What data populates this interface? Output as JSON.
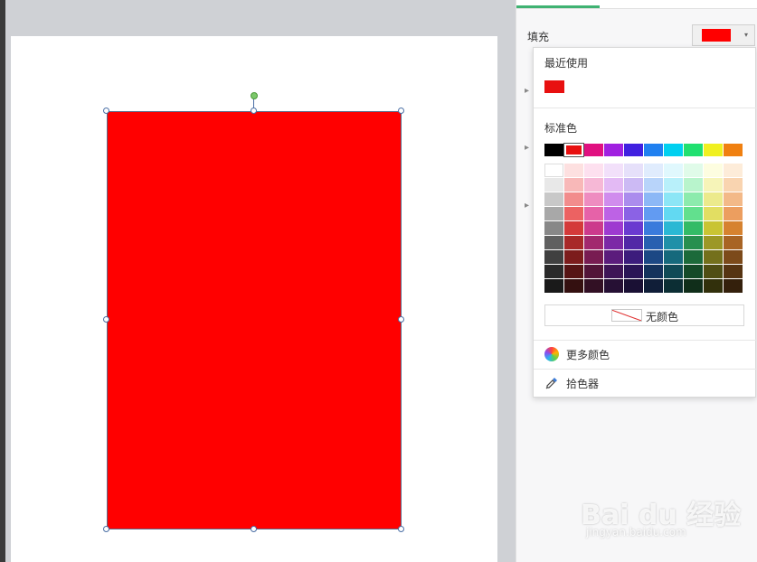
{
  "panel": {
    "fill_label": "填充",
    "fill_color": "#ff0000",
    "dropdown_arrow": "▾"
  },
  "popup": {
    "recent_title": "最近使用",
    "recent_colors": [
      "#e81010"
    ],
    "standard_title": "标准色",
    "standard_colors": [
      "#000000",
      "#e81010",
      "#e01080",
      "#a020e0",
      "#4020e0",
      "#2080f0",
      "#00d0f0",
      "#20e070",
      "#f0f020",
      "#f08010"
    ],
    "theme_grid": [
      [
        "#ffffff",
        "#fde0e0",
        "#fde0ef",
        "#f2e0fa",
        "#e6e0fa",
        "#e0ecfd",
        "#e0f8fd",
        "#e0fbe9",
        "#fdfde0",
        "#fdecd9"
      ],
      [
        "#e8e8e8",
        "#f8b8b8",
        "#f6b8d6",
        "#e3baf4",
        "#ccbaf4",
        "#b8d4fa",
        "#b8f0fa",
        "#b8f4cc",
        "#f6f4b8",
        "#f9d4b0"
      ],
      [
        "#c8c8c8",
        "#f28c8c",
        "#ee8cc0",
        "#d08ced",
        "#ab8ced",
        "#8cb8f6",
        "#8ce6f6",
        "#8cebad",
        "#ecea8c",
        "#f3b988"
      ],
      [
        "#a8a8a8",
        "#ec6262",
        "#e662a8",
        "#bd62e5",
        "#8b62e5",
        "#629bf2",
        "#62d9f2",
        "#62e08e",
        "#e2de62",
        "#ec9e5f"
      ],
      [
        "#888888",
        "#d43a3a",
        "#cc3a8c",
        "#9e3ad0",
        "#6a3ad0",
        "#3a7bdc",
        "#2ab8d4",
        "#33bb66",
        "#c9c433",
        "#d6822f"
      ],
      [
        "#606060",
        "#a82828",
        "#a2286e",
        "#7c28a6",
        "#5228a6",
        "#2860b0",
        "#1f90a8",
        "#278f4f",
        "#9c9826",
        "#a86424"
      ],
      [
        "#404040",
        "#7c1c1c",
        "#781c52",
        "#5b1c7c",
        "#3c1c7c",
        "#1c4884",
        "#16697c",
        "#1c6a3a",
        "#74701c",
        "#7c4a1a"
      ],
      [
        "#2a2a2a",
        "#561414",
        "#521438",
        "#3e1456",
        "#2a1456",
        "#14325c",
        "#104a56",
        "#144a28",
        "#504e14",
        "#563412"
      ],
      [
        "#1a1a1a",
        "#341010",
        "#321024",
        "#261034",
        "#1a1034",
        "#101e38",
        "#0c2e34",
        "#102e1a",
        "#32300c",
        "#34200c"
      ]
    ],
    "no_color_label": "无颜色",
    "more_colors_label": "更多颜色",
    "picker_label": "拾色器"
  },
  "watermark": {
    "main": "Bai du 经验",
    "sub": "jingyan.baidu.com"
  }
}
